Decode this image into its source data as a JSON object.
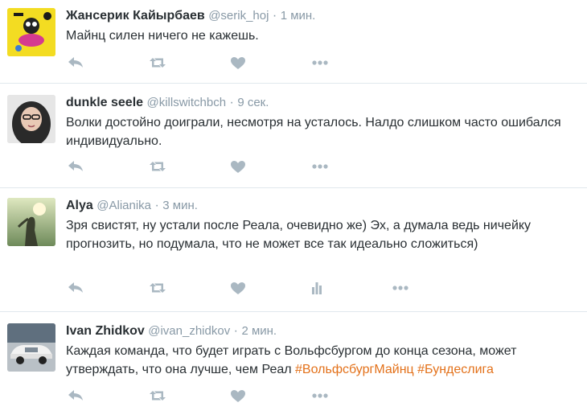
{
  "tweets": [
    {
      "fullname": "Жансерик Кайырбаев",
      "handle": "@serik_hoj",
      "time": "1 мин.",
      "text": "Майнц силен ничего не кажешь.",
      "avatar_icon": "cartoon-avatar-icon"
    },
    {
      "fullname": "dunkle seele",
      "handle": "@killswitchbch",
      "time": "9 сек.",
      "text": "Волки достойно доиграли, несмотря на усталось. Налдо слишком часто ошибался индивидуально.",
      "avatar_icon": "photo-avatar-icon"
    },
    {
      "fullname": "Alya",
      "handle": "@Alianika",
      "time": "3 мин.",
      "text": "Зря свистят, ну устали после Реала, очевидно же) Эх, а думала ведь ничейку прогнозить, но подумала, что не может все так идеально сложиться)",
      "avatar_icon": "photo-avatar-icon"
    },
    {
      "fullname": "Ivan Zhidkov",
      "handle": "@ivan_zhidkov",
      "time": "2 мин.",
      "text": "Каждая команда, что будет играть с Вольфсбургом до конца сезона, может утверждать, что она лучше, чем Реал",
      "hashtags": [
        "#ВольфсбургМайнц",
        "#Бундеслига"
      ],
      "avatar_icon": "car-photo-avatar-icon"
    }
  ],
  "separator": "·",
  "colors": {
    "hashtag": "#e3711a",
    "meta": "#8899a6",
    "icon": "#aab8c2",
    "divider": "#e1e8ed"
  },
  "action_icons": [
    "reply-icon",
    "retweet-icon",
    "like-icon",
    "analytics-icon",
    "more-icon"
  ]
}
